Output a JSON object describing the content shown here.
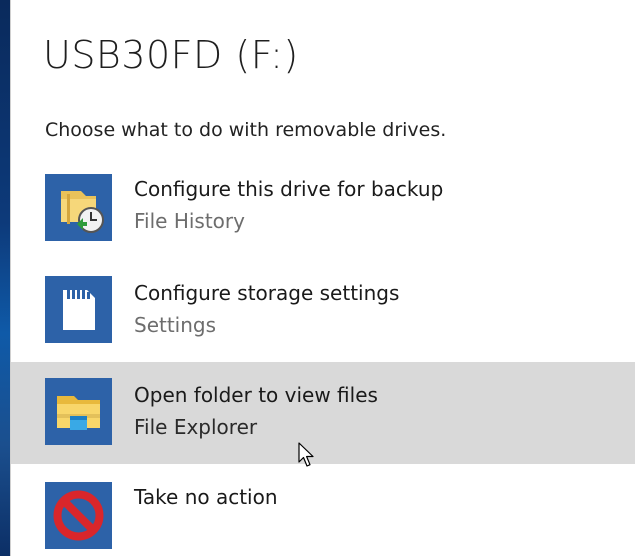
{
  "dialog": {
    "title": "USB30FD (F:)",
    "subtitle": "Choose what to do with removable drives."
  },
  "options": [
    {
      "title": "Configure this drive for backup",
      "subtitle": "File History",
      "icon": "file-history-icon"
    },
    {
      "title": "Configure storage settings",
      "subtitle": "Settings",
      "icon": "sd-card-icon"
    },
    {
      "title": "Open folder to view files",
      "subtitle": "File Explorer",
      "icon": "file-explorer-icon",
      "highlighted": true
    },
    {
      "title": "Take no action",
      "subtitle": "",
      "icon": "no-action-icon"
    }
  ],
  "colors": {
    "icon_tile": "#2d62a8",
    "highlight": "#d9d9d9",
    "no_action_red": "#d9262b"
  }
}
